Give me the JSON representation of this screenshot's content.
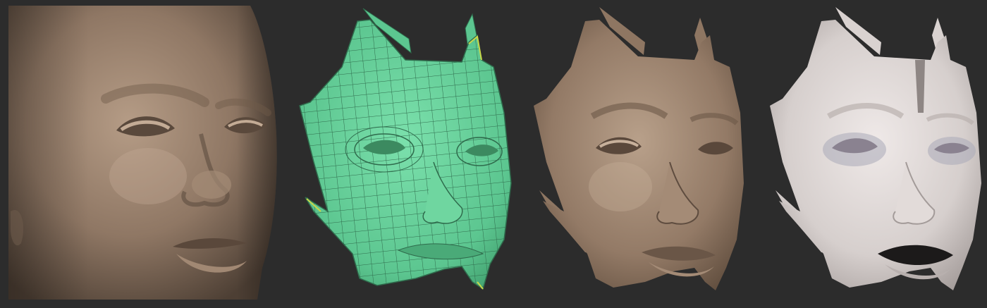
{
  "image": {
    "description_panels": [
      {
        "id": "head",
        "icon": "sculpted-head-icon"
      },
      {
        "id": "wireframe",
        "icon": "wireframe-mask-icon"
      },
      {
        "id": "clay",
        "icon": "clay-mask-icon"
      },
      {
        "id": "pale",
        "icon": "pale-mask-icon"
      }
    ],
    "colors": {
      "background": "#2c2c2c",
      "clay": "#8e7662",
      "clay_light": "#b39a84",
      "clay_dark": "#4a3b30",
      "wire": "#5fcf95",
      "wire_line": "#2f6b4c",
      "pale": "#d9d2d0",
      "pale_dark": "#8e8684"
    }
  }
}
